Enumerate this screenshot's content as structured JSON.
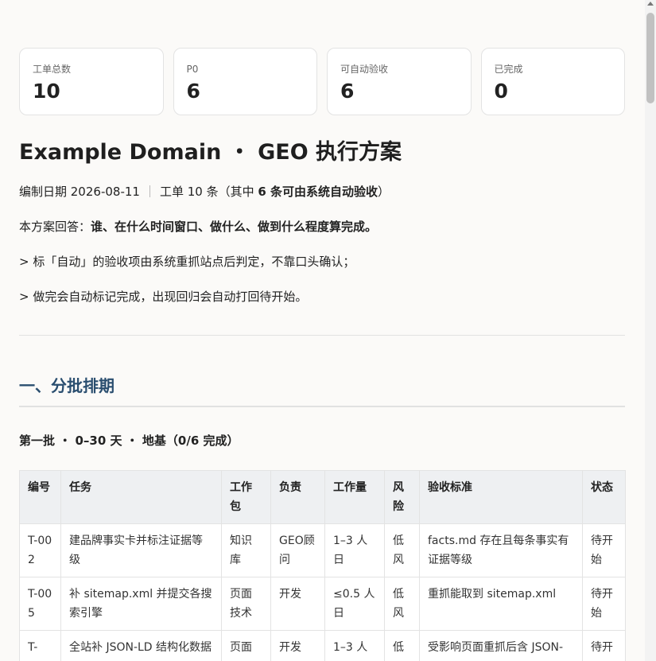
{
  "stats": [
    {
      "label": "工单总数",
      "value": "10"
    },
    {
      "label": "P0",
      "value": "6"
    },
    {
      "label": "可自动验收",
      "value": "6"
    },
    {
      "label": "已完成",
      "value": "0"
    }
  ],
  "title": "Example Domain ・ GEO 执行方案",
  "meta": {
    "date": "编制日期 2026-08-11",
    "sep": "｜",
    "count_prefix": "工单 10 条（其中 ",
    "count_bold": "6 条可由系统自动验收",
    "count_suffix": "）"
  },
  "intro": {
    "prefix": "本方案回答：",
    "bold": "谁、在什么时间窗口、做什么、做到什么程度算完成。"
  },
  "notes": [
    "> 标「自动」的验收项由系统重抓站点后判定，不靠口头确认；",
    "> 做完会自动标记完成，出现回归会自动打回待开始。"
  ],
  "section": {
    "title": "一、分批排期"
  },
  "batch": {
    "title": "第一批 ・ 0–30 天 ・ 地基（0/6 完成）"
  },
  "table": {
    "headers": [
      "编号",
      "任务",
      "工作包",
      "负责",
      "工作量",
      "风险",
      "验收标准",
      "状态"
    ],
    "rows": [
      [
        "T-002",
        "建品牌事实卡并标注证据等级",
        "知识库",
        "GEO顾问",
        "1–3 人日",
        "低风",
        "facts.md 存在且每条事实有证据等级",
        "待开始"
      ],
      [
        "T-005",
        "补 sitemap.xml 并提交各搜索引擎",
        "页面技术",
        "开发",
        "≤0.5 人日",
        "低风",
        "重抓能取到 sitemap.xml",
        "待开始"
      ],
      [
        "T-",
        "全站补 JSON-LD 结构化数据",
        "页面",
        "开发",
        "1–3 人",
        "低",
        "受影响页面重抓后含 JSON-",
        "待开"
      ]
    ]
  }
}
